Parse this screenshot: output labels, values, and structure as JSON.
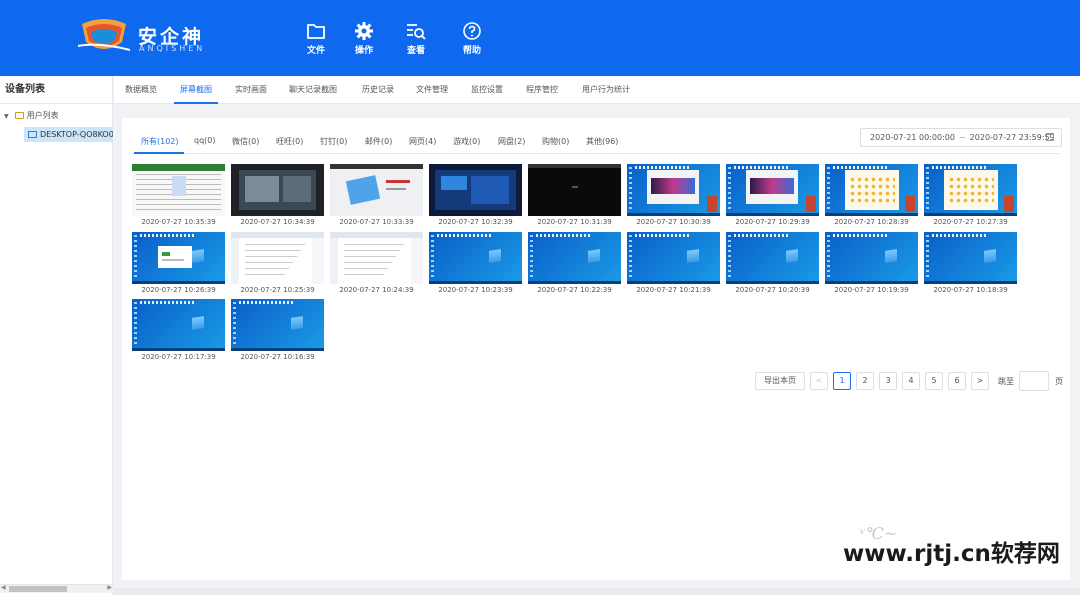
{
  "header": {
    "brand_name": "安企神",
    "brand_sub": "ANQISHEN",
    "nav": [
      {
        "label": "文件",
        "icon": "folder-icon"
      },
      {
        "label": "操作",
        "icon": "gear-icon"
      },
      {
        "label": "查看",
        "icon": "search-list-icon"
      },
      {
        "label": "帮助",
        "icon": "help-icon"
      }
    ]
  },
  "sidebar": {
    "title": "设备列表",
    "tree_root": "用户列表",
    "device": "DESKTOP-QO8KO0"
  },
  "top_tabs": [
    "数据概览",
    "屏幕截图",
    "实时画面",
    "聊天记录截图",
    "历史记录",
    "文件管理",
    "监控设置",
    "程序管控",
    "用户行为统计"
  ],
  "active_top_tab": "屏幕截图",
  "sub_tabs": [
    "所有(102)",
    "qq(0)",
    "微信(0)",
    "旺旺(0)",
    "钉钉(0)",
    "邮件(0)",
    "网页(4)",
    "游戏(0)",
    "网盘(2)",
    "购物(0)",
    "其他(96)"
  ],
  "active_sub_tab": "所有(102)",
  "date_range": {
    "start": "2020-07-21 00:00:00",
    "sep": "~",
    "end": "2020-07-27 23:59:59"
  },
  "screenshots": [
    {
      "time": "2020-07-27 10:35:39",
      "kind": "spreadsheet"
    },
    {
      "time": "2020-07-27 10:34:39",
      "kind": "dark-app"
    },
    {
      "time": "2020-07-27 10:33:39",
      "kind": "web-light"
    },
    {
      "time": "2020-07-27 10:32:39",
      "kind": "dark-blue-web"
    },
    {
      "time": "2020-07-27 10:31:39",
      "kind": "black"
    },
    {
      "time": "2020-07-27 10:30:39",
      "kind": "desktop-browser"
    },
    {
      "time": "2020-07-27 10:29:39",
      "kind": "desktop-browser"
    },
    {
      "time": "2020-07-27 10:28:39",
      "kind": "desktop-icons"
    },
    {
      "time": "2020-07-27 10:27:39",
      "kind": "desktop-icons"
    },
    {
      "time": "2020-07-27 10:26:39",
      "kind": "desktop-dialog"
    },
    {
      "time": "2020-07-27 10:25:39",
      "kind": "document"
    },
    {
      "time": "2020-07-27 10:24:39",
      "kind": "document"
    },
    {
      "time": "2020-07-27 10:23:39",
      "kind": "desktop"
    },
    {
      "time": "2020-07-27 10:22:39",
      "kind": "desktop"
    },
    {
      "time": "2020-07-27 10:21:39",
      "kind": "desktop"
    },
    {
      "time": "2020-07-27 10:20:39",
      "kind": "desktop"
    },
    {
      "time": "2020-07-27 10:19:39",
      "kind": "desktop"
    },
    {
      "time": "2020-07-27 10:18:39",
      "kind": "desktop"
    },
    {
      "time": "2020-07-27 10:17:39",
      "kind": "desktop"
    },
    {
      "time": "2020-07-27 10:16:39",
      "kind": "desktop"
    }
  ],
  "pagination": {
    "export_label": "导出本页",
    "prev": "<",
    "next": ">",
    "pages": [
      "1",
      "2",
      "3",
      "4",
      "5",
      "6"
    ],
    "current": "1",
    "jump_label": "跳至",
    "jump_unit": "页"
  },
  "watermark": {
    "text": "www.rjtj.cn软荐网"
  },
  "colors": {
    "header_blue": "#0e69ee",
    "accent": "#1a73e8",
    "desktop_blue": "#1688d8",
    "active_node_bg": "#cbe6fb"
  }
}
